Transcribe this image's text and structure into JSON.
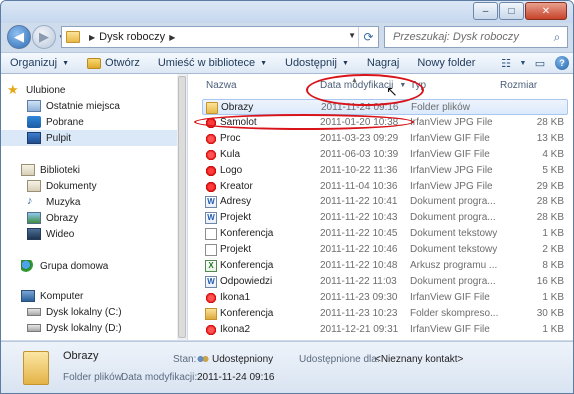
{
  "window": {
    "caption_buttons": [
      "minimize-icon",
      "maximize-icon",
      "close-icon"
    ]
  },
  "nav": {
    "address_segments": [
      "Dysk roboczy"
    ],
    "search_placeholder": "Przeszukaj: Dysk roboczy"
  },
  "toolbar": {
    "organize": "Organizuj",
    "open": "Otwórz",
    "library": "Umieść w bibliotece",
    "share": "Udostępnij",
    "burn": "Nagraj",
    "new_folder": "Nowy folder"
  },
  "sidebar": {
    "favorites": "Ulubione",
    "recent": "Ostatnie miejsca",
    "downloads": "Pobrane",
    "desktop": "Pulpit",
    "libraries": "Biblioteki",
    "documents": "Dokumenty",
    "music": "Muzyka",
    "pictures": "Obrazy",
    "video": "Wideo",
    "homegroup": "Grupa domowa",
    "computer": "Komputer",
    "drive_c": "Dysk lokalny (C:)",
    "drive_d": "Dysk lokalny (D:)"
  },
  "columns": {
    "name": "Nazwa",
    "date": "Data modyfikacji",
    "type": "Typ",
    "size": "Rozmiar"
  },
  "files": [
    {
      "name": "Obrazy",
      "date": "2011-11-24 09:16",
      "type": "Folder plików",
      "size": "",
      "icon": "folder"
    },
    {
      "name": "Samolot",
      "date": "2011-01-20 10:38",
      "type": "IrfanView JPG File",
      "size": "28 KB",
      "icon": "jpg"
    },
    {
      "name": "Proc",
      "date": "2011-03-23 09:29",
      "type": "IrfanView GIF File",
      "size": "13 KB",
      "icon": "gif"
    },
    {
      "name": "Kula",
      "date": "2011-06-03 10:39",
      "type": "IrfanView GIF File",
      "size": "4 KB",
      "icon": "gif"
    },
    {
      "name": "Logo",
      "date": "2011-10-22 11:36",
      "type": "IrfanView JPG File",
      "size": "5 KB",
      "icon": "jpg"
    },
    {
      "name": "Kreator",
      "date": "2011-11-04 10:36",
      "type": "IrfanView JPG File",
      "size": "29 KB",
      "icon": "jpg"
    },
    {
      "name": "Adresy",
      "date": "2011-11-22 10:41",
      "type": "Dokument progra...",
      "size": "28 KB",
      "icon": "doc"
    },
    {
      "name": "Projekt",
      "date": "2011-11-22 10:43",
      "type": "Dokument progra...",
      "size": "28 KB",
      "icon": "doc"
    },
    {
      "name": "Konferencja",
      "date": "2011-11-22 10:45",
      "type": "Dokument tekstowy",
      "size": "1 KB",
      "icon": "txt"
    },
    {
      "name": "Projekt",
      "date": "2011-11-22 10:46",
      "type": "Dokument tekstowy",
      "size": "2 KB",
      "icon": "txt"
    },
    {
      "name": "Konferencja",
      "date": "2011-11-22 10:48",
      "type": "Arkusz programu ...",
      "size": "8 KB",
      "icon": "xls"
    },
    {
      "name": "Odpowiedzi",
      "date": "2011-11-22 11:03",
      "type": "Dokument progra...",
      "size": "16 KB",
      "icon": "doc"
    },
    {
      "name": "Ikona1",
      "date": "2011-11-23 09:30",
      "type": "IrfanView GIF File",
      "size": "1 KB",
      "icon": "gif"
    },
    {
      "name": "Konferencja",
      "date": "2011-11-23 10:23",
      "type": "Folder skompreso...",
      "size": "30 KB",
      "icon": "zip"
    },
    {
      "name": "Ikona2",
      "date": "2011-12-21 09:31",
      "type": "IrfanView GIF File",
      "size": "1 KB",
      "icon": "gif"
    }
  ],
  "details": {
    "name": "Obrazy",
    "type": "Folder plików",
    "state_label": "Stan:",
    "state_value": "Udostępniony",
    "shared_label": "Udostępnione dla:",
    "shared_value": "<Nieznany kontakt>",
    "date_label": "Data modyfikacji:",
    "date_value": "2011-11-24 09:16"
  }
}
